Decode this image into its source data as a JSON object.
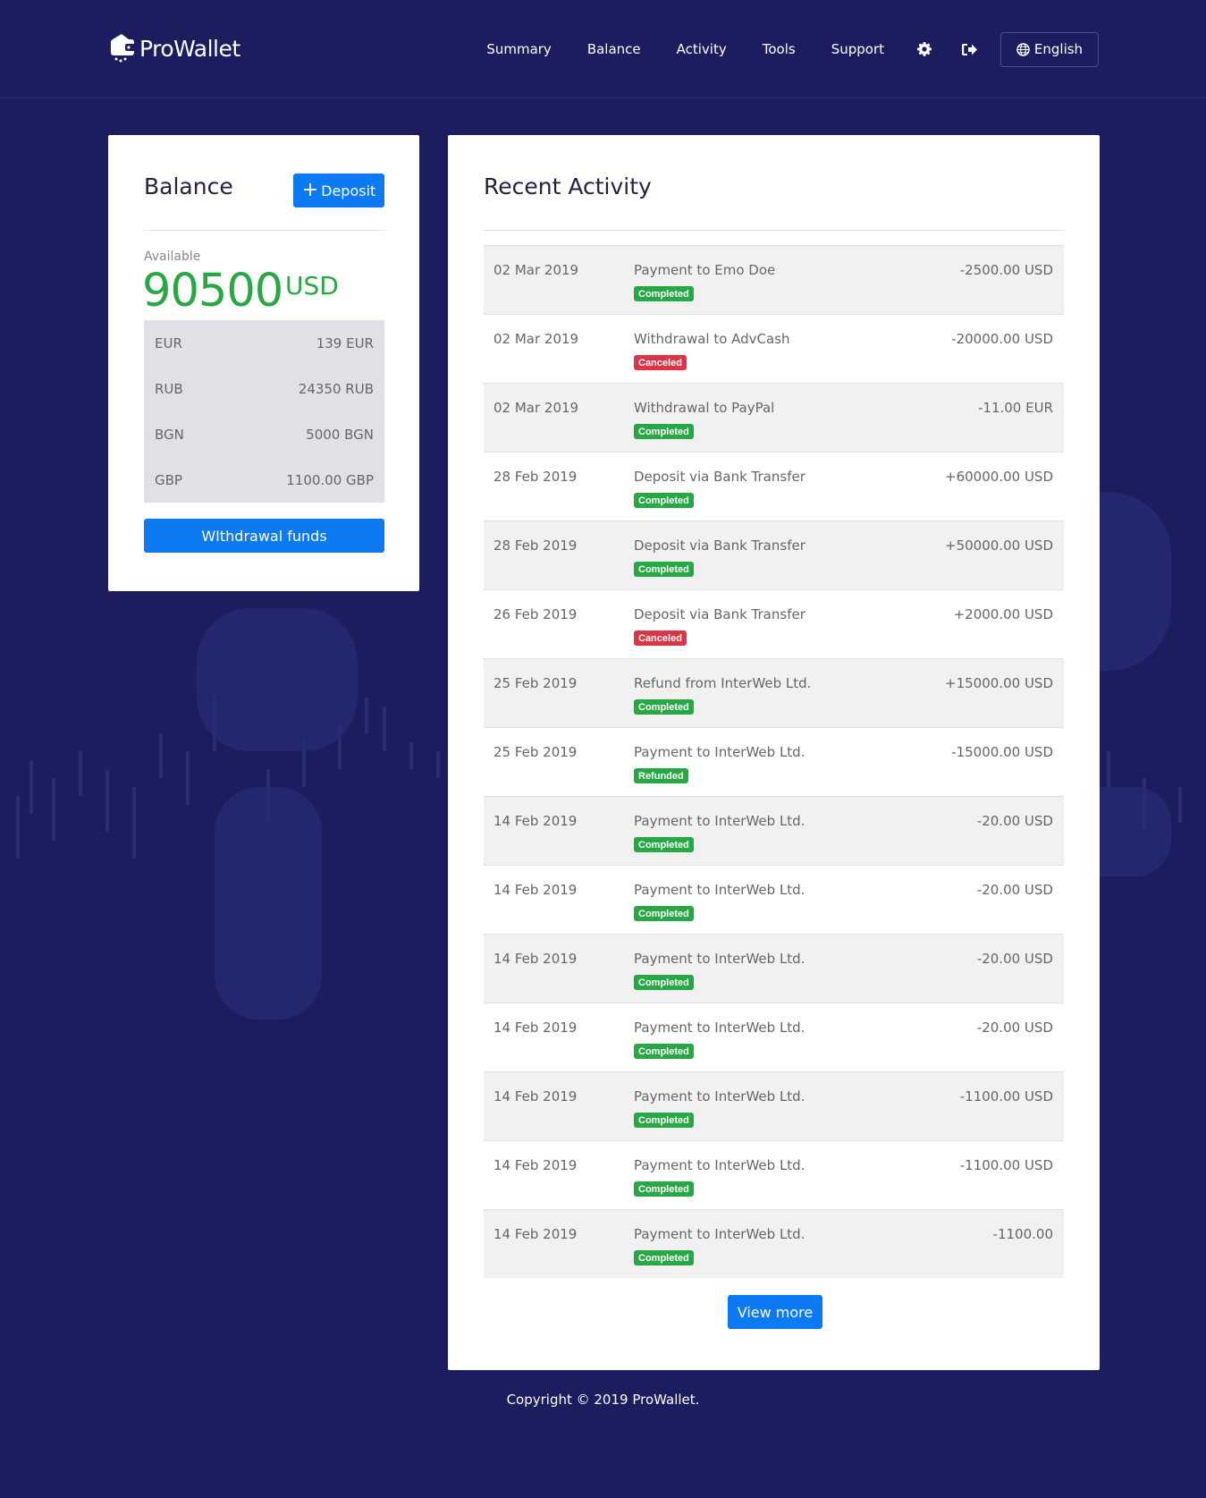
{
  "brand": {
    "name": "ProWallet"
  },
  "nav": {
    "links": [
      "Summary",
      "Balance",
      "Activity",
      "Tools",
      "Support"
    ],
    "language": "English"
  },
  "balance": {
    "title": "Balance",
    "deposit_label": "Deposit",
    "available_label": "Available",
    "available_amount": "90500",
    "available_currency": "USD",
    "currencies": [
      {
        "code": "EUR",
        "amount": "139 EUR"
      },
      {
        "code": "RUB",
        "amount": "24350 RUB"
      },
      {
        "code": "BGN",
        "amount": "5000 BGN"
      },
      {
        "code": "GBP",
        "amount": "1100.00 GBP"
      }
    ],
    "withdraw_label": "WIthdrawal funds"
  },
  "activity": {
    "title": "Recent Activity",
    "items": [
      {
        "date": "02 Mar 2019",
        "desc": "Payment to Emo Doe",
        "status": "Completed",
        "amount": "-2500.00 USD"
      },
      {
        "date": "02 Mar 2019",
        "desc": "Withdrawal to AdvCash",
        "status": "Canceled",
        "amount": "-20000.00 USD"
      },
      {
        "date": "02 Mar 2019",
        "desc": "Withdrawal to PayPal",
        "status": "Completed",
        "amount": "-11.00 EUR"
      },
      {
        "date": "28 Feb 2019",
        "desc": "Deposit via Bank Transfer",
        "status": "Completed",
        "amount": "+60000.00 USD"
      },
      {
        "date": "28 Feb 2019",
        "desc": "Deposit via Bank Transfer",
        "status": "Completed",
        "amount": "+50000.00 USD"
      },
      {
        "date": "26 Feb 2019",
        "desc": "Deposit via Bank Transfer",
        "status": "Canceled",
        "amount": "+2000.00 USD"
      },
      {
        "date": "25 Feb 2019",
        "desc": "Refund from InterWeb Ltd.",
        "status": "Completed",
        "amount": "+15000.00 USD"
      },
      {
        "date": "25 Feb 2019",
        "desc": "Payment to InterWeb Ltd.",
        "status": "Refunded",
        "amount": "-15000.00 USD"
      },
      {
        "date": "14 Feb 2019",
        "desc": "Payment to InterWeb Ltd.",
        "status": "Completed",
        "amount": "-20.00 USD"
      },
      {
        "date": "14 Feb 2019",
        "desc": "Payment to InterWeb Ltd.",
        "status": "Completed",
        "amount": "-20.00 USD"
      },
      {
        "date": "14 Feb 2019",
        "desc": "Payment to InterWeb Ltd.",
        "status": "Completed",
        "amount": "-20.00 USD"
      },
      {
        "date": "14 Feb 2019",
        "desc": "Payment to InterWeb Ltd.",
        "status": "Completed",
        "amount": "-20.00 USD"
      },
      {
        "date": "14 Feb 2019",
        "desc": "Payment to InterWeb Ltd.",
        "status": "Completed",
        "amount": "-1100.00 USD"
      },
      {
        "date": "14 Feb 2019",
        "desc": "Payment to InterWeb Ltd.",
        "status": "Completed",
        "amount": "-1100.00 USD"
      },
      {
        "date": "14 Feb 2019",
        "desc": "Payment to InterWeb Ltd.",
        "status": "Completed",
        "amount": "-1100.00"
      }
    ],
    "view_more_label": "View more"
  },
  "footer": {
    "copyright": "Copyright © 2019 ProWallet."
  },
  "colors": {
    "background": "#1b1d5e",
    "primary": "#0d7af3",
    "success": "#28a745",
    "danger": "#dc3545"
  },
  "icons": [
    "logo-wallet-icon",
    "gear-icon",
    "logout-icon",
    "globe-icon",
    "plus-icon"
  ]
}
